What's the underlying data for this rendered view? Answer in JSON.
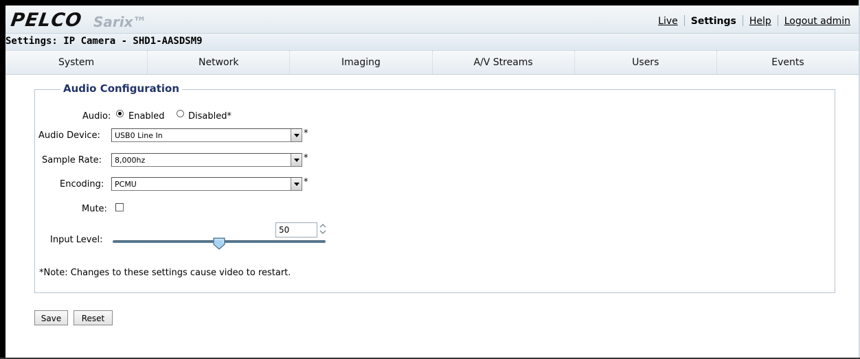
{
  "header": {
    "logo": "PELCO",
    "product": "Sarix™",
    "nav": [
      {
        "label": "Live"
      },
      {
        "label": "Settings"
      },
      {
        "label": "Help"
      },
      {
        "label": "Logout admin"
      }
    ]
  },
  "page_title": "Settings: IP Camera - SHD1-AASDSM9",
  "tabs": [
    {
      "label": "System"
    },
    {
      "label": "Network"
    },
    {
      "label": "Imaging"
    },
    {
      "label": "A/V Streams"
    },
    {
      "label": "Users"
    },
    {
      "label": "Events"
    }
  ],
  "audio_config": {
    "legend": "Audio Configuration",
    "audio_label": "Audio:",
    "enabled_label": "Enabled",
    "disabled_label": "Disabled*",
    "audio_selected": "Enabled",
    "device_label": "Audio Device:",
    "device_value": "USB0 Line In",
    "sample_rate_label": "Sample Rate:",
    "sample_rate_value": "8,000hz",
    "encoding_label": "Encoding:",
    "encoding_value": "PCMU",
    "required_mark": "*",
    "mute_label": "Mute:",
    "mute_checked": false,
    "input_level_label": "Input Level:",
    "input_level_value": "50",
    "note": "*Note: Changes to these settings cause video to restart."
  },
  "buttons": {
    "save": "Save",
    "reset": "Reset"
  },
  "colors": {
    "legend": "#22336b",
    "slider": "#4a6a82",
    "thumb": "#8fc3ea"
  }
}
